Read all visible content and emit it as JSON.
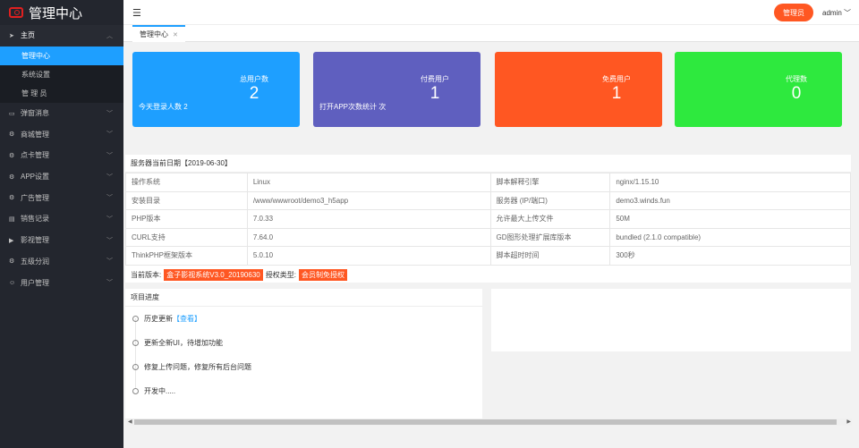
{
  "brand": {
    "title": "管理中心"
  },
  "sidebar": {
    "items": [
      {
        "label": "主页",
        "icon": "paper-plane-icon"
      },
      {
        "label": "弹窗消息",
        "icon": "message-icon"
      },
      {
        "label": "商城管理",
        "icon": "settings-icon"
      },
      {
        "label": "点卡管理",
        "icon": "card-icon"
      },
      {
        "label": "APP设置",
        "icon": "settings-icon"
      },
      {
        "label": "广告管理",
        "icon": "settings-icon"
      },
      {
        "label": "销售记录",
        "icon": "file-icon"
      },
      {
        "label": "影视管理",
        "icon": "play-icon"
      },
      {
        "label": "五级分润",
        "icon": "settings-icon"
      },
      {
        "label": "用户管理",
        "icon": "user-icon"
      }
    ],
    "sub_items": [
      "管理中心",
      "系统设置",
      "管 理 员"
    ]
  },
  "header": {
    "menu_icon": "☰",
    "role_button": "管理员",
    "user": "admin"
  },
  "tabs": [
    {
      "label": "管理中心",
      "close": "✕"
    }
  ],
  "cards": [
    {
      "title": "总用户数",
      "value": "2",
      "note": "今天登录人数 2",
      "color": "#1e9fff"
    },
    {
      "title": "付费用户",
      "value": "1",
      "note": "打开APP次数统计 次",
      "color": "#5f5fbf"
    },
    {
      "title": "免费用户",
      "value": "1",
      "note": "",
      "color": "#ff5722"
    },
    {
      "title": "代理数",
      "value": "0",
      "note": "",
      "color": "#2ee93e"
    }
  ],
  "server": {
    "title": "服务器当前日期【2019-06-30】",
    "rows": [
      [
        "操作系统",
        "Linux",
        "脚本解释引擎",
        "nginx/1.15.10"
      ],
      [
        "安装目录",
        "/www/wwwroot/demo3_h5app",
        "服务器 (IP/端口)",
        "demo3.winds.fun"
      ],
      [
        "PHP版本",
        "7.0.33",
        "允许最大上传文件",
        "50M"
      ],
      [
        "CURL支持",
        "7.64.0",
        "GD图形处理扩展库版本",
        "bundled (2.1.0 compatible)"
      ],
      [
        "ThinkPHP框架版本",
        "5.0.10",
        "脚本超时时间",
        "300秒"
      ]
    ],
    "version_label": "当前版本:",
    "version": "盒子影视系统V3.0_20190630",
    "auth_label": "授权类型:",
    "auth": "会员制免授权"
  },
  "project": {
    "title": "项目进度",
    "items": [
      {
        "text": "历史更新",
        "link": "【查看】"
      },
      {
        "text": "更新全新UI，待增加功能",
        "link": ""
      },
      {
        "text": "修复上传问题，修复所有后台问题",
        "link": ""
      },
      {
        "text": "开发中.....",
        "link": ""
      }
    ]
  }
}
